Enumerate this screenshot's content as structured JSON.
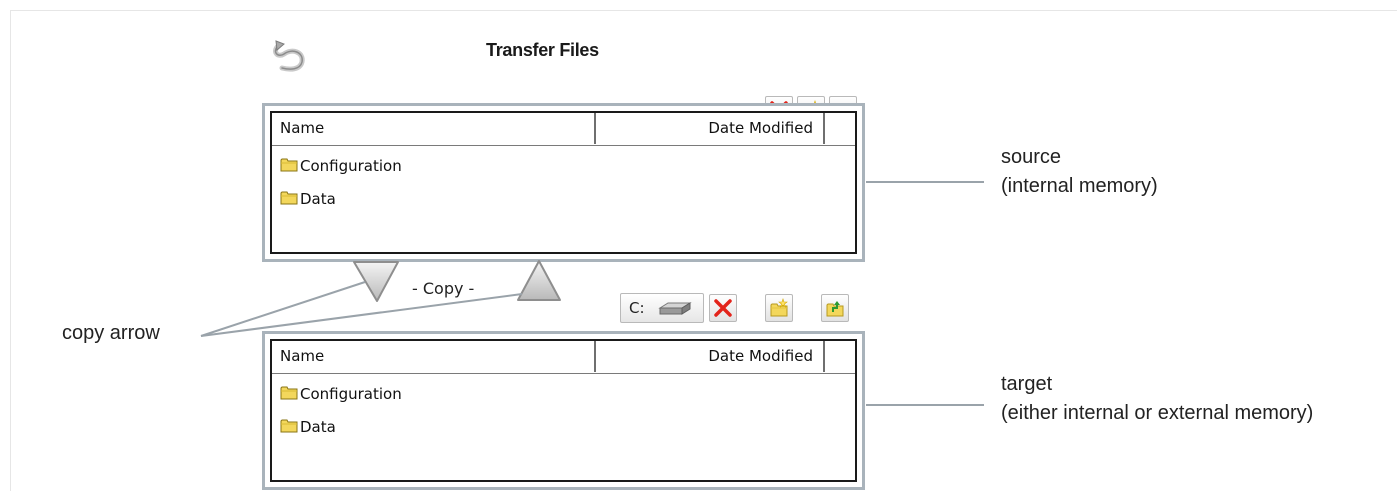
{
  "window": {
    "title": "Transfer Files"
  },
  "toolbar": {
    "delete_icon": "delete-x-icon",
    "new_folder_icon": "new-folder-icon",
    "up_folder_icon": "folder-up-icon",
    "back_icon": "back-arrow-icon"
  },
  "source": {
    "columns": {
      "name": "Name",
      "date": "Date Modified"
    },
    "items": [
      {
        "label": "Configuration"
      },
      {
        "label": "Data"
      }
    ]
  },
  "copy": {
    "label": "- Copy -"
  },
  "target": {
    "drive": {
      "label": "C:"
    },
    "columns": {
      "name": "Name",
      "date": "Date Modified"
    },
    "items": [
      {
        "label": "Configuration"
      },
      {
        "label": "Data"
      }
    ]
  },
  "annotations": {
    "copy_arrow": "copy arrow",
    "source_line1": "source",
    "source_line2": "(internal memory)",
    "target_line1": "target",
    "target_line2": "(either internal or external memory)"
  },
  "colors": {
    "panel_border": "#a9b3bb",
    "delete_red": "#e3241b",
    "folder_yellow": "#f3d75c",
    "up_green": "#2e9a2e",
    "callout_line": "#9aa3aa"
  }
}
